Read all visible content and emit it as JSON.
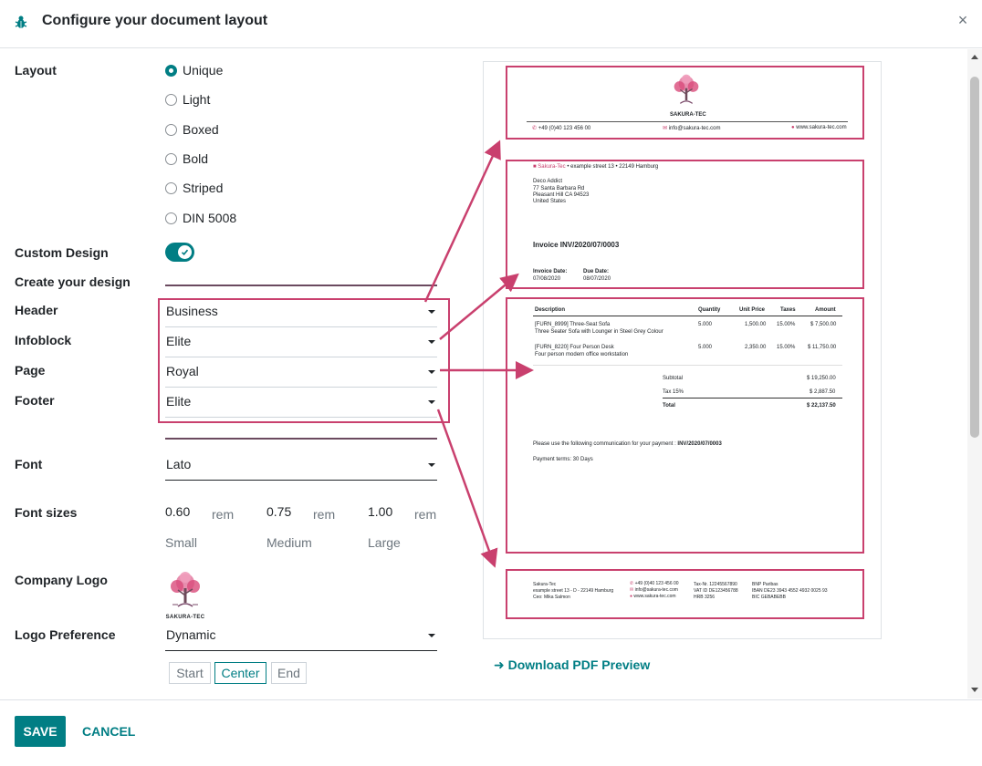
{
  "dialog": {
    "title": "Configure your document layout",
    "close": "×"
  },
  "labels": {
    "layout": "Layout",
    "custom_design": "Custom Design",
    "create_design": "Create your design",
    "header": "Header",
    "infoblock": "Infoblock",
    "page": "Page",
    "footer": "Footer",
    "font": "Font",
    "font_sizes": "Font sizes",
    "company_logo": "Company Logo",
    "logo_preference": "Logo Preference"
  },
  "layout_options": [
    {
      "label": "Unique",
      "checked": true
    },
    {
      "label": "Light",
      "checked": false
    },
    {
      "label": "Boxed",
      "checked": false
    },
    {
      "label": "Bold",
      "checked": false
    },
    {
      "label": "Striped",
      "checked": false
    },
    {
      "label": "DIN 5008",
      "checked": false
    }
  ],
  "custom_design_enabled": true,
  "design": {
    "header": "Business",
    "infoblock": "Elite",
    "page": "Royal",
    "footer": "Elite"
  },
  "font": "Lato",
  "font_sizes": {
    "small": {
      "value": "0.60",
      "unit": "rem",
      "caption": "Small"
    },
    "medium": {
      "value": "0.75",
      "unit": "rem",
      "caption": "Medium"
    },
    "large": {
      "value": "1.00",
      "unit": "rem",
      "caption": "Large"
    }
  },
  "logo_preference": "Dynamic",
  "logo_position": {
    "start": "Start",
    "center": "Center",
    "end": "End",
    "selected": "Center"
  },
  "preview": {
    "company_name": "SAKURA-TEC",
    "phone": "+49 (0)40 123 456 00",
    "email": "info@sakura-tec.com",
    "website": "www.sakura-tec.com",
    "sender_line_company": "Sakura-Tec",
    "sender_line_address": "example street 13  •  22149 Hamburg",
    "recipient": [
      "Deco Addict",
      "77 Santa Barbara Rd",
      "Pleasant Hill CA 94523",
      "United States"
    ],
    "invoice_title": "Invoice INV/2020/07/0003",
    "invoice_date_label": "Invoice Date:",
    "invoice_date": "07/08/2020",
    "due_date_label": "Due Date:",
    "due_date": "08/07/2020",
    "table_headers": [
      "Description",
      "Quantity",
      "Unit Price",
      "Taxes",
      "Amount"
    ],
    "lines": [
      {
        "desc1": "[FURN_8999] Three-Seat Sofa",
        "desc2": "Three Seater Sofa with Lounger in Steel Grey Colour",
        "qty": "5.000",
        "price": "1,500.00",
        "tax": "15.00%",
        "amount": "$ 7,500.00"
      },
      {
        "desc1": "[FURN_8220] Four Person Desk",
        "desc2": "Four person modern office workstation",
        "qty": "5.000",
        "price": "2,350.00",
        "tax": "15.00%",
        "amount": "$ 11,750.00"
      }
    ],
    "subtotal_label": "Subtotal",
    "subtotal": "$ 19,250.00",
    "tax_label": "Tax 15%",
    "tax": "$ 2,887.50",
    "total_label": "Total",
    "total": "$ 22,137.50",
    "communication_text": "Please use the following communication for your payment : ",
    "communication_ref": "INV/2020/07/0003",
    "payment_terms": "Payment terms: 30 Days",
    "footer_col1": [
      "Sakura-Tec",
      "example street 13  -  D - 22149 Hamburg",
      "Ceo:  Mika Salmon"
    ],
    "footer_col2": [
      "+49 (0)40 123 456 00",
      "info@sakura-tec.com",
      "www.sakura-tec.com"
    ],
    "footer_col3": [
      "Tax-Nr.  12245567890",
      "VAT ID   DE123456788",
      "HRB 3256"
    ],
    "footer_col4": [
      "BNP Paribas",
      "IBAN    DE23 3943 4552 4932 0025 93",
      "BIC      GEBABEBB"
    ]
  },
  "download_label": "Download PDF Preview",
  "footer": {
    "save": "SAVE",
    "cancel": "CANCEL"
  },
  "colors": {
    "accent": "#017e84",
    "highlight": "#c9406e",
    "brand_pink": "#d94b7a"
  }
}
